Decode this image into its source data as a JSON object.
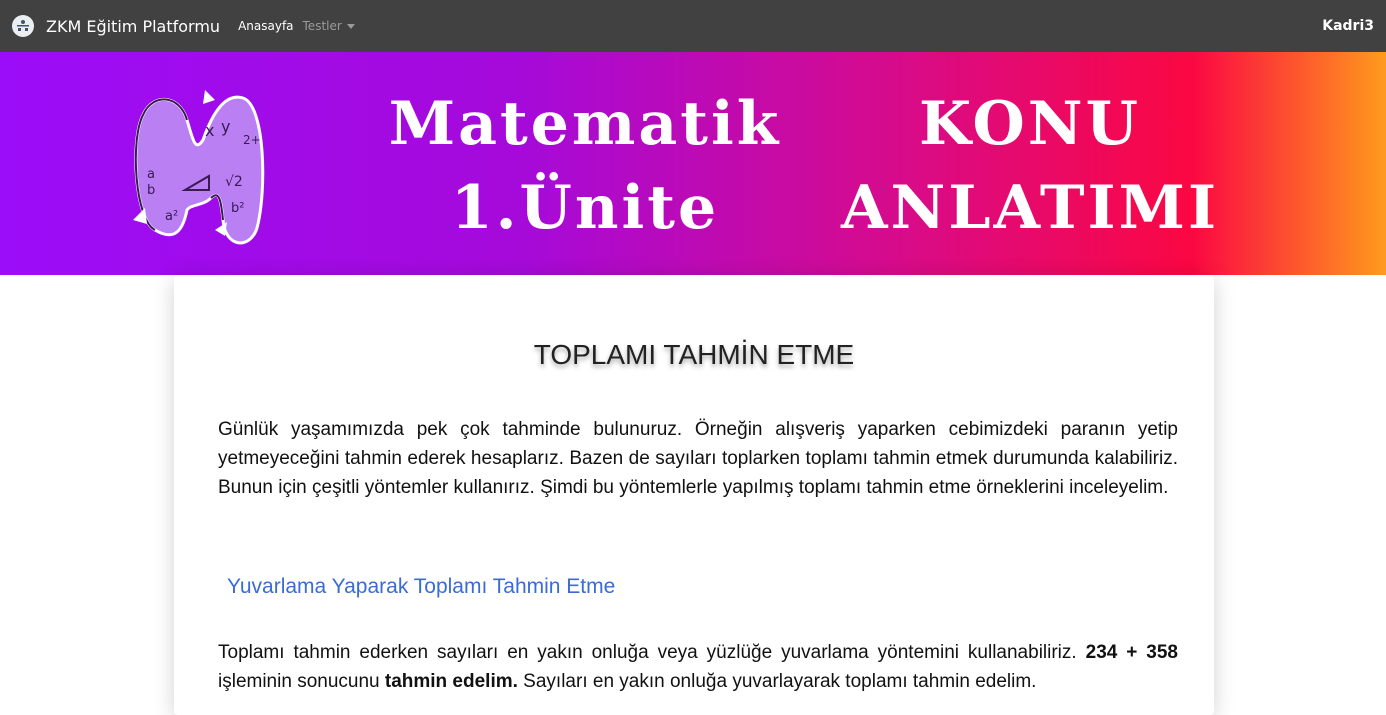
{
  "navbar": {
    "brand": "ZKM Eğitim Platformu",
    "home": "Anasayfa",
    "tests": "Testler",
    "user": "Kadri3"
  },
  "banner": {
    "title_left_line1": "Matematik",
    "title_left_line2": "1.Ünite",
    "title_right_line1": "KONU",
    "title_right_line2": "ANLATIMI",
    "logo_text": [
      "x",
      "y",
      "2+",
      "a",
      "b",
      "√2",
      "b²",
      "a²"
    ]
  },
  "content": {
    "title": "TOPLAMI TAHMİN ETME",
    "paragraph1": "Günlük yaşamımızda pek çok tahminde bulunuruz. Örneğin alışveriş yaparken cebimizdeki paranın yetip yetmeyeceğini tahmin ederek hesaplarız. Bazen de sayıları toplarken toplamı tahmin etmek durumunda kalabiliriz. Bunun için çeşitli yöntemler kullanırız. Şimdi bu yöntemlerle yapılmış toplamı tahmin etme örneklerini inceleyelim.",
    "section_title": "Yuvarlama Yaparak Toplamı Tahmin Etme",
    "p2_a": "Toplamı tahmin ederken sayıları en yakın onluğa veya yüzlüğe yuvarlama yöntemini kullanabiliriz. ",
    "p2_b": "234 + 358",
    "p2_c": " işleminin sonucunu ",
    "p2_d": "tahmin edelim.",
    "p2_e": " Sayıları en yakın onluğa yuvarlayarak toplamı tahmin edelim."
  },
  "colors": {
    "navbar_bg": "#414141",
    "section_title": "#3a6bd6",
    "banner_gradient": [
      "#9b0cf8",
      "#d90b87",
      "#fb0742",
      "#ff9a1c"
    ]
  }
}
